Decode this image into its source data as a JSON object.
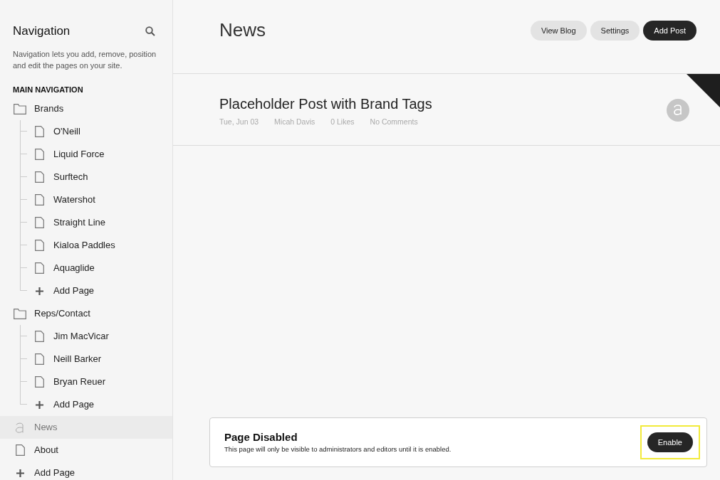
{
  "sidebar": {
    "title": "Navigation",
    "description": "Navigation lets you add, remove, position and edit the pages on your site.",
    "section_label": "MAIN NAVIGATION",
    "items": [
      {
        "kind": "folder",
        "label": "Brands",
        "selected": false,
        "children": [
          {
            "kind": "page",
            "label": "O'Neill",
            "selected": false
          },
          {
            "kind": "page",
            "label": "Liquid Force",
            "selected": false
          },
          {
            "kind": "page",
            "label": "Surftech",
            "selected": false
          },
          {
            "kind": "page",
            "label": "Watershot",
            "selected": false
          },
          {
            "kind": "page",
            "label": "Straight Line",
            "selected": false
          },
          {
            "kind": "page",
            "label": "Kialoa Paddles",
            "selected": false
          },
          {
            "kind": "page",
            "label": "Aquaglide",
            "selected": false
          },
          {
            "kind": "add",
            "label": "Add Page",
            "selected": false
          }
        ]
      },
      {
        "kind": "folder",
        "label": "Reps/Contact",
        "selected": false,
        "children": [
          {
            "kind": "page",
            "label": "Jim MacVicar",
            "selected": false
          },
          {
            "kind": "page",
            "label": "Neill Barker",
            "selected": false
          },
          {
            "kind": "page",
            "label": "Bryan Reuer",
            "selected": false
          },
          {
            "kind": "add",
            "label": "Add Page",
            "selected": false
          }
        ]
      },
      {
        "kind": "blog",
        "label": "News",
        "selected": true
      },
      {
        "kind": "page",
        "label": "About",
        "selected": false
      },
      {
        "kind": "add",
        "label": "Add Page",
        "selected": false
      }
    ]
  },
  "header": {
    "title": "News",
    "buttons": [
      {
        "label": "View Blog",
        "primary": false
      },
      {
        "label": "Settings",
        "primary": false
      },
      {
        "label": "Add Post",
        "primary": true
      }
    ]
  },
  "posts": [
    {
      "title": "Placeholder Post with Brand Tags",
      "meta": [
        "Tue, Jun 03",
        "Micah Davis",
        "0 Likes",
        "No Comments"
      ]
    }
  ],
  "notice": {
    "title": "Page Disabled",
    "text": "This page will only be visible to administrators and editors until it is enabled.",
    "button": {
      "label": "Enable",
      "focused": true
    }
  }
}
